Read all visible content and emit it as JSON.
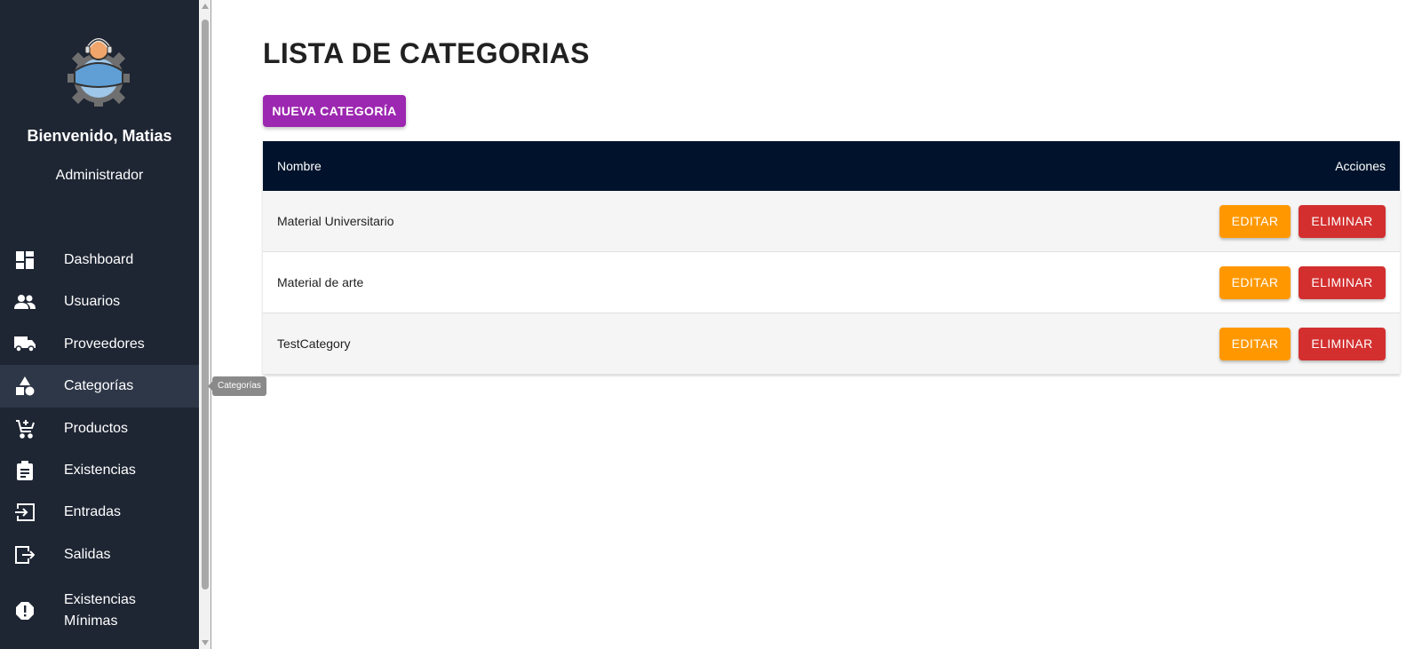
{
  "sidebar": {
    "welcome": "Bienvenido, Matias",
    "role": "Administrador",
    "items": [
      {
        "label": "Dashboard",
        "icon": "dashboard-icon"
      },
      {
        "label": "Usuarios",
        "icon": "people-icon"
      },
      {
        "label": "Proveedores",
        "icon": "truck-icon"
      },
      {
        "label": "Categorías",
        "icon": "category-icon",
        "active": true
      },
      {
        "label": "Productos",
        "icon": "cart-icon"
      },
      {
        "label": "Existencias",
        "icon": "clipboard-icon"
      },
      {
        "label": "Entradas",
        "icon": "login-icon"
      },
      {
        "label": "Salidas",
        "icon": "logout-icon"
      },
      {
        "label": "Existencias Mínimas",
        "icon": "alert-icon"
      }
    ]
  },
  "tooltip": "Categorías",
  "main": {
    "title": "LISTA DE CATEGORIAS",
    "new_button": "NUEVA CATEGORÍA",
    "table": {
      "headers": [
        "Nombre",
        "Acciones"
      ],
      "rows": [
        {
          "name": "Material Universitario"
        },
        {
          "name": "Material de arte"
        },
        {
          "name": "TestCategory"
        }
      ],
      "edit_label": "EDITAR",
      "delete_label": "ELIMINAR"
    }
  },
  "colors": {
    "sidebar_bg": "#1e2533",
    "header_bg": "#01132c",
    "new_button": "#9c27b0",
    "edit_button": "#ff9800",
    "delete_button": "#d32f2f"
  }
}
